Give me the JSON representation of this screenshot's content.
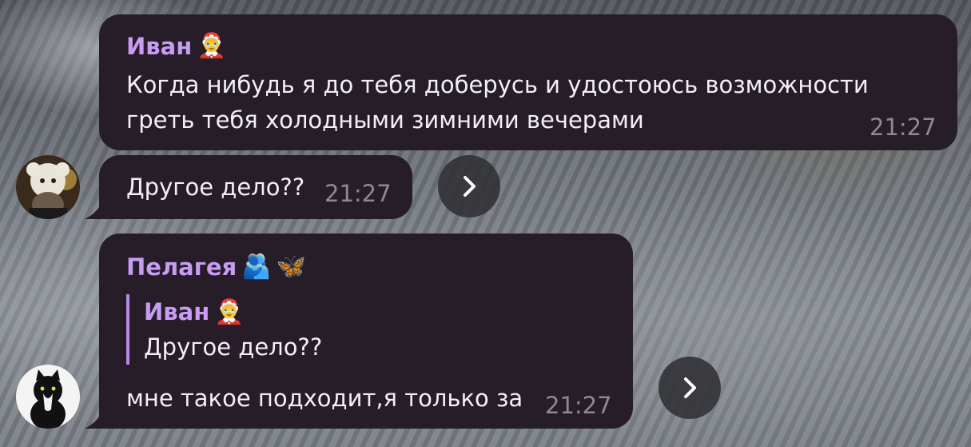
{
  "messages": [
    {
      "sender": "Иван",
      "sender_emoji": "🤶",
      "text_line1": "Когда нибудь я до тебя доберусь и удостоюсь возможности",
      "text_line2": "греть тебя холодными зимними вечерами",
      "time": "21:27"
    },
    {
      "text": "Другое дело??",
      "time": "21:27",
      "avatar": "snow-bear-hat-photo",
      "forward_icon": "chevron-right-icon"
    },
    {
      "sender": "Пелагея",
      "sender_emoji1": "🫂",
      "sender_emoji2": "🦋",
      "reply": {
        "sender": "Иван",
        "sender_emoji": "🤶",
        "text": "Другое дело??"
      },
      "text": "мне такое подходит,я только за",
      "time": "21:27",
      "avatar": "black-white-cat-photo",
      "forward_icon": "chevron-right-icon"
    }
  ],
  "colors": {
    "bubble": "#261d29",
    "sender_name": "#c79cf2",
    "timestamp": "#8f8794",
    "text": "#f2f0f4"
  }
}
